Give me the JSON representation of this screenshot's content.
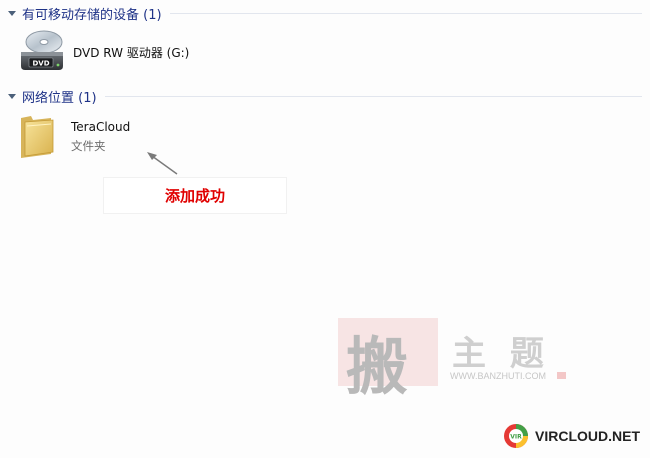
{
  "groups": {
    "removable": {
      "title": "有可移动存储的设备 (1)"
    },
    "network": {
      "title": "网络位置 (1)"
    }
  },
  "items": {
    "dvd": {
      "label": "DVD RW 驱动器 (G:)",
      "icon_text": "DVD"
    },
    "teracloud": {
      "label": "TeraCloud",
      "type": "文件夹"
    }
  },
  "annotation": {
    "text": "添加成功"
  },
  "watermark": {
    "main_char": "搬",
    "sub_chars": "主 题",
    "url": "WWW.BANZHUTI.COM",
    "brand": "VIRCLOUD.NET",
    "badge": "VIR"
  },
  "colors": {
    "header_text": "#1e3287",
    "annotation_text": "#e00000"
  }
}
